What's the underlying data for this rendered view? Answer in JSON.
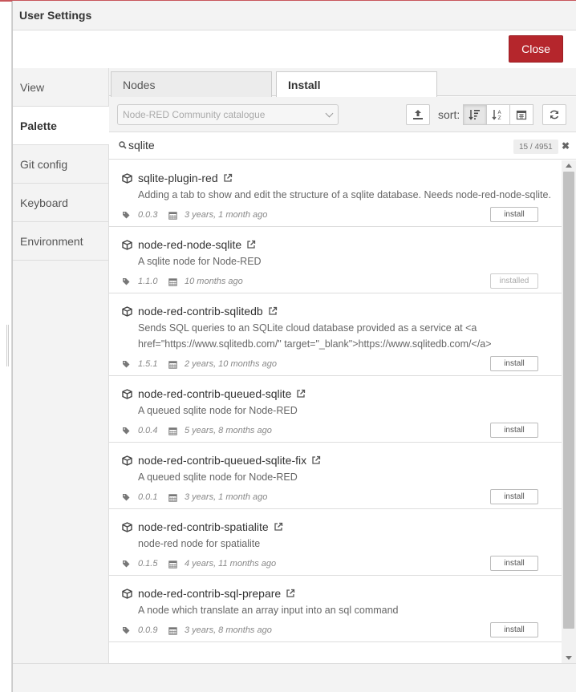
{
  "dialog": {
    "title": "User Settings",
    "close_label": "Close"
  },
  "sidebar": {
    "items": [
      {
        "label": "View",
        "active": false
      },
      {
        "label": "Palette",
        "active": true
      },
      {
        "label": "Git config",
        "active": false
      },
      {
        "label": "Keyboard",
        "active": false
      },
      {
        "label": "Environment",
        "active": false
      }
    ]
  },
  "tabs": [
    {
      "label": "Nodes"
    },
    {
      "label": "Install"
    }
  ],
  "filter": {
    "catalogue": "Node-RED Community catalogue",
    "sort_label": "sort:"
  },
  "search": {
    "value": "sqlite",
    "count": "15 / 4951"
  },
  "packages": [
    {
      "name": "sqlite-plugin-red",
      "desc": "Adding a tab to show and edit the structure of a sqlite database. Needs node-red-node-sqlite.",
      "version": "0.0.3",
      "updated": "3 years, 1 month ago",
      "action": "install"
    },
    {
      "name": "node-red-node-sqlite",
      "desc": "A sqlite node for Node-RED",
      "version": "1.1.0",
      "updated": "10 months ago",
      "action": "installed"
    },
    {
      "name": "node-red-contrib-sqlitedb",
      "desc": "Sends SQL queries to an SQLite cloud database provided as a service at <a href=\"https://www.sqlitedb.com/\" target=\"_blank\">https://www.sqlitedb.com/</a>",
      "version": "1.5.1",
      "updated": "2 years, 10 months ago",
      "action": "install"
    },
    {
      "name": "node-red-contrib-queued-sqlite",
      "desc": "A queued sqlite node for Node-RED",
      "version": "0.0.4",
      "updated": "5 years, 8 months ago",
      "action": "install"
    },
    {
      "name": "node-red-contrib-queued-sqlite-fix",
      "desc": "A queued sqlite node for Node-RED",
      "version": "0.0.1",
      "updated": "3 years, 1 month ago",
      "action": "install"
    },
    {
      "name": "node-red-contrib-spatialite",
      "desc": "node-red node for spatialite",
      "version": "0.1.5",
      "updated": "4 years, 11 months ago",
      "action": "install"
    },
    {
      "name": "node-red-contrib-sql-prepare",
      "desc": "A node which translate an array input into an sql command",
      "version": "0.0.9",
      "updated": "3 years, 8 months ago",
      "action": "install"
    }
  ],
  "colors": {
    "close_button": "#b5262c",
    "panel_bg": "#f3f3f3"
  }
}
